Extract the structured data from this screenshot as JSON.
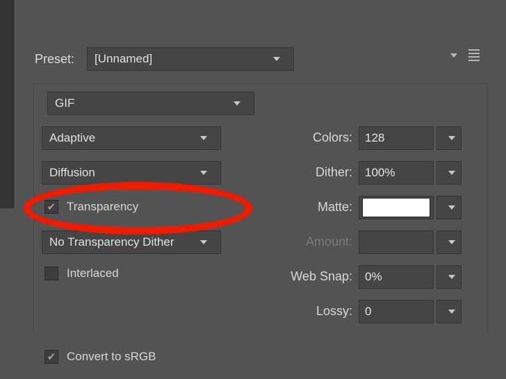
{
  "preset": {
    "label": "Preset:",
    "value": "[Unnamed]"
  },
  "format": {
    "value": "GIF"
  },
  "reduction": {
    "value": "Adaptive"
  },
  "dither_algo": {
    "value": "Diffusion"
  },
  "transparency": {
    "label": "Transparency",
    "checked": true
  },
  "trans_dither": {
    "value": "No Transparency Dither"
  },
  "interlaced": {
    "label": "Interlaced",
    "checked": false
  },
  "right": {
    "colors": {
      "label": "Colors:",
      "value": "128"
    },
    "dither": {
      "label": "Dither:",
      "value": "100%"
    },
    "matte": {
      "label": "Matte:",
      "value": "#ffffff"
    },
    "amount": {
      "label": "Amount:",
      "value": ""
    },
    "websnap": {
      "label": "Web Snap:",
      "value": "0%"
    },
    "lossy": {
      "label": "Lossy:",
      "value": "0"
    }
  },
  "convert_srgb": {
    "label": "Convert to sRGB",
    "checked": true
  }
}
